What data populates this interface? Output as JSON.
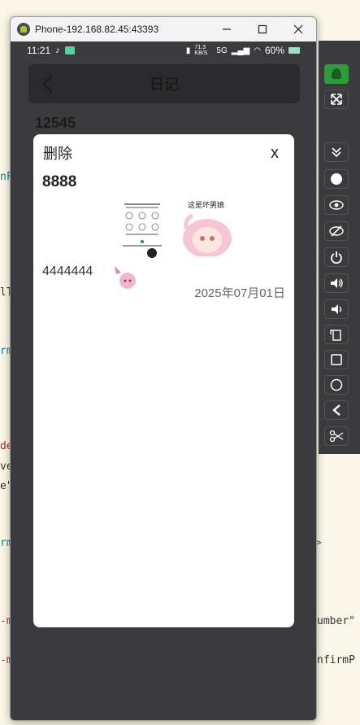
{
  "background_code": [
    {
      "text": "nFo",
      "color": "#1f7a8c"
    },
    {
      "text": "lT",
      "color": "#333333"
    },
    {
      "text": "rm",
      "color": "#1f7a8c"
    },
    {
      "text": "de",
      "color": "#b22222"
    },
    {
      "text": "ve",
      "color": "#333333"
    },
    {
      "text": "e\"",
      "color": "#333333"
    },
    {
      "text": "rm",
      "color": "#1f7a8c"
    },
    {
      "text": ">",
      "color": "#1f7a8c"
    },
    {
      "text": "-m",
      "color": "#b22222"
    },
    {
      "text": "umber\"",
      "color": "#333333"
    },
    {
      "text": "-m",
      "color": "#b22222"
    },
    {
      "text": "nfirmP",
      "color": "#333333"
    }
  ],
  "window": {
    "title": "Phone-192.168.82.45:43393"
  },
  "status_bar": {
    "time": "11:21",
    "speed": "71.3 KB/S",
    "network": "5G",
    "battery": "60%"
  },
  "app": {
    "header_title": "日记",
    "list_first_entry_title": "12545"
  },
  "dialog": {
    "title": "删除",
    "close_label": "x",
    "entry_title": "8888",
    "entry_body": "4444444",
    "entry_date": "2025年07月01日",
    "image2_caption": "这是坏男娘"
  },
  "colors": {
    "window_bg": "#3b3a3c",
    "dialog_bg": "#ffffff",
    "desktop_bg": "#fbf7e8"
  },
  "toolbar": {
    "buttons": [
      {
        "icon": "android-icon"
      },
      {
        "icon": "fullscreen-icon"
      },
      {
        "icon": "chevron-double-down-icon"
      },
      {
        "icon": "record-icon"
      },
      {
        "icon": "eye-icon"
      },
      {
        "icon": "eye-off-icon"
      },
      {
        "icon": "power-icon"
      },
      {
        "icon": "volume-up-icon"
      },
      {
        "icon": "volume-down-icon"
      },
      {
        "icon": "rotate-icon"
      },
      {
        "icon": "square-icon"
      },
      {
        "icon": "circle-icon"
      },
      {
        "icon": "back-icon"
      },
      {
        "icon": "scissors-icon"
      }
    ]
  }
}
